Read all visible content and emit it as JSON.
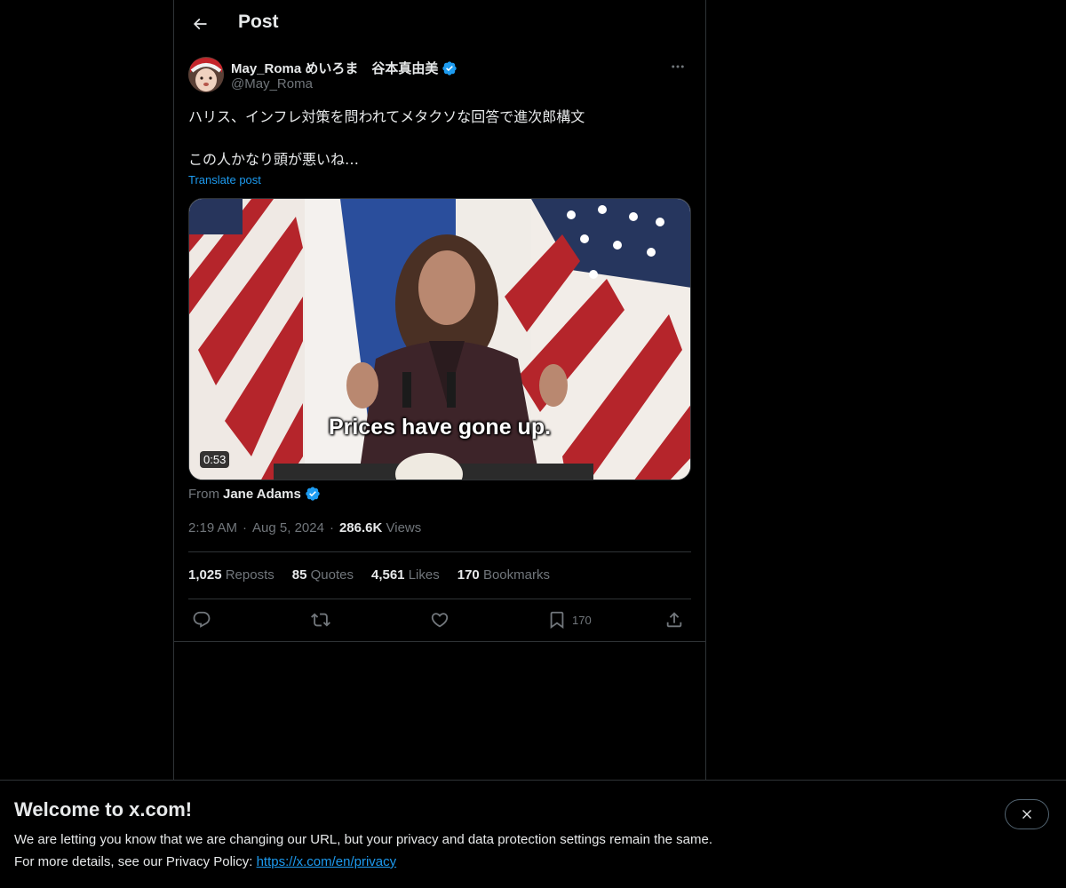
{
  "header": {
    "title": "Post"
  },
  "post": {
    "author": {
      "display_name": "May_Roma めいろま　谷本真由美",
      "handle": "@May_Roma",
      "verified_color": "#1d9bf0"
    },
    "text_lines": [
      "ハリス、インフレ対策を問われてメタクソな回答で進次郎構文",
      "この人かなり頭が悪いね…"
    ],
    "translate_label": "Translate post",
    "media": {
      "caption": "Prices have gone up.",
      "duration": "0:53"
    },
    "from": {
      "label": "From",
      "name": "Jane Adams"
    },
    "meta": {
      "time": "2:19 AM",
      "date": "Aug 5, 2024",
      "views_count": "286.6K",
      "views_label": "Views",
      "separator": "·"
    },
    "stats": {
      "reposts_count": "1,025",
      "reposts_label": "Reposts",
      "quotes_count": "85",
      "quotes_label": "Quotes",
      "likes_count": "4,561",
      "likes_label": "Likes",
      "bookmarks_count": "170",
      "bookmarks_label": "Bookmarks"
    },
    "actions": {
      "reply_icon": "reply-icon",
      "repost_icon": "repost-icon",
      "like_icon": "heart-icon",
      "bookmark_icon": "bookmark-icon",
      "bookmark_count": "170",
      "share_icon": "share-icon"
    }
  },
  "banner": {
    "title": "Welcome to x.com!",
    "line1": "We are letting you know that we are changing our URL, but your privacy and data protection settings remain the same.",
    "line2_prefix": "For more details, see our Privacy Policy: ",
    "link": "https://x.com/en/privacy"
  },
  "colors": {
    "background": "#000000",
    "text": "#e7e9ea",
    "muted": "#71767b",
    "accent": "#1d9bf0",
    "border": "#2f3336"
  }
}
